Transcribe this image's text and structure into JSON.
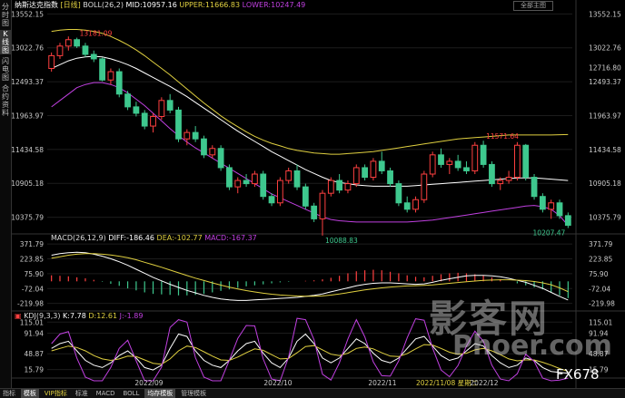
{
  "sidebar": {
    "items": [
      "分时图",
      "K线图",
      "闪电图",
      "合约资料"
    ]
  },
  "header": {
    "name": "纳斯达克指数",
    "period": "[日线]",
    "boll_label": "BOLL(26,2)",
    "mid": "MID:10957.16",
    "upper": "UPPER:11666.83",
    "lower": "LOWER:10247.49",
    "dropdown": "全部主图"
  },
  "macd_header": {
    "name": "MACD(26,12,9)",
    "diff": "DIFF:-186.46",
    "dea": "DEA:-102.77",
    "macd": "MACD:-167.37"
  },
  "kdj_header": {
    "name": "KDJ(9,3,3)",
    "k": "K:7.78",
    "d": "D:12.61",
    "j": "J:-1.89"
  },
  "colors": {
    "up": "#ff4040",
    "down": "#3ec88e",
    "mid": "#ffffff",
    "upper": "#e0d040",
    "lower": "#c040e0"
  },
  "chart_data": [
    {
      "type": "candlestick",
      "name": "纳斯达克指数",
      "x_labels": [
        "2022/09",
        "2022/10",
        "2022/11",
        "2022/11/08 星期二",
        "2022/12"
      ],
      "ylim": [
        10200,
        13600
      ],
      "y_ticks": [
        13552.15,
        13022.76,
        12493.37,
        11963.97,
        11434.58,
        10905.18,
        10375.79
      ],
      "right_extra_tick": 12716.8,
      "annotations": [
        {
          "text": "13181.09",
          "value": 13181.09
        },
        {
          "text": "10088.83",
          "value": 10088.83
        },
        {
          "text": "11571.64",
          "value": 11571.64
        },
        {
          "text": "10207.47",
          "value": 10207.47
        }
      ],
      "ohlc": [
        [
          12700,
          12950,
          12650,
          12900
        ],
        [
          12900,
          13100,
          12850,
          13050
        ],
        [
          13050,
          13200,
          12980,
          13150
        ],
        [
          13150,
          13181,
          13020,
          13050
        ],
        [
          13050,
          13100,
          12880,
          12920
        ],
        [
          12920,
          12980,
          12800,
          12850
        ],
        [
          12850,
          12870,
          12500,
          12520
        ],
        [
          12520,
          12700,
          12450,
          12650
        ],
        [
          12650,
          12700,
          12250,
          12300
        ],
        [
          12300,
          12350,
          12050,
          12100
        ],
        [
          12100,
          12180,
          11950,
          12000
        ],
        [
          12000,
          12050,
          11750,
          11800
        ],
        [
          11800,
          12000,
          11700,
          11950
        ],
        [
          11950,
          12250,
          11900,
          12200
        ],
        [
          12200,
          12300,
          12000,
          12050
        ],
        [
          12050,
          12100,
          11550,
          11600
        ],
        [
          11600,
          11750,
          11500,
          11700
        ],
        [
          11700,
          11800,
          11550,
          11600
        ],
        [
          11600,
          11650,
          11300,
          11350
        ],
        [
          11350,
          11500,
          11300,
          11450
        ],
        [
          11450,
          11500,
          11100,
          11150
        ],
        [
          11150,
          11200,
          10800,
          10850
        ],
        [
          10850,
          11000,
          10750,
          10950
        ],
        [
          10950,
          11050,
          10850,
          10900
        ],
        [
          10900,
          11100,
          10850,
          11050
        ],
        [
          11050,
          11100,
          10650,
          10700
        ],
        [
          10700,
          10750,
          10550,
          10600
        ],
        [
          10600,
          11000,
          10550,
          10950
        ],
        [
          10950,
          11150,
          10900,
          11100
        ],
        [
          11100,
          11200,
          10800,
          10850
        ],
        [
          10850,
          10900,
          10500,
          10550
        ],
        [
          10550,
          10600,
          10300,
          10350
        ],
        [
          10350,
          10800,
          10088,
          10750
        ],
        [
          10750,
          11000,
          10700,
          10950
        ],
        [
          10950,
          11050,
          10750,
          10800
        ],
        [
          10800,
          10950,
          10750,
          10900
        ],
        [
          10900,
          11200,
          10850,
          11150
        ],
        [
          11150,
          11200,
          10950,
          11000
        ],
        [
          11000,
          11300,
          10950,
          11250
        ],
        [
          11250,
          11400,
          11050,
          11100
        ],
        [
          11100,
          11150,
          10850,
          10900
        ],
        [
          10900,
          10950,
          10550,
          10600
        ],
        [
          10600,
          10700,
          10450,
          10500
        ],
        [
          10500,
          10700,
          10450,
          10650
        ],
        [
          10650,
          11100,
          10600,
          11050
        ],
        [
          11050,
          11400,
          11000,
          11350
        ],
        [
          11350,
          11450,
          11150,
          11200
        ],
        [
          11200,
          11300,
          11050,
          11250
        ],
        [
          11250,
          11350,
          11100,
          11150
        ],
        [
          11150,
          11250,
          11050,
          11100
        ],
        [
          11100,
          11550,
          11050,
          11500
        ],
        [
          11500,
          11571,
          11150,
          11200
        ],
        [
          11200,
          11250,
          10850,
          10900
        ],
        [
          10900,
          11000,
          10800,
          10950
        ],
        [
          10950,
          11100,
          10900,
          11000
        ],
        [
          11000,
          11550,
          10950,
          11500
        ],
        [
          11500,
          11520,
          10950,
          11000
        ],
        [
          11000,
          11050,
          10650,
          10700
        ],
        [
          10700,
          10750,
          10450,
          10500
        ],
        [
          10500,
          10650,
          10350,
          10600
        ],
        [
          10600,
          10650,
          10350,
          10400
        ],
        [
          10400,
          10450,
          10207,
          10250
        ]
      ],
      "boll_mid": [
        12700,
        12760,
        12820,
        12860,
        12880,
        12890,
        12880,
        12850,
        12810,
        12760,
        12700,
        12630,
        12560,
        12490,
        12420,
        12340,
        12260,
        12170,
        12080,
        11990,
        11900,
        11810,
        11720,
        11640,
        11560,
        11480,
        11400,
        11330,
        11260,
        11190,
        11120,
        11060,
        11000,
        10950,
        10920,
        10900,
        10880,
        10870,
        10860,
        10860,
        10860,
        10860,
        10860,
        10870,
        10880,
        10890,
        10900,
        10910,
        10920,
        10930,
        10940,
        10950,
        10960,
        10970,
        10980,
        10990,
        10990,
        10990,
        10980,
        10970,
        10960,
        10950
      ],
      "boll_upper": [
        13280,
        13300,
        13310,
        13310,
        13300,
        13280,
        13250,
        13200,
        13140,
        13070,
        12990,
        12900,
        12800,
        12700,
        12600,
        12490,
        12380,
        12270,
        12160,
        12060,
        11960,
        11870,
        11790,
        11710,
        11640,
        11580,
        11530,
        11490,
        11450,
        11420,
        11400,
        11380,
        11370,
        11360,
        11360,
        11370,
        11380,
        11390,
        11400,
        11420,
        11440,
        11460,
        11480,
        11500,
        11520,
        11540,
        11560,
        11580,
        11600,
        11610,
        11620,
        11630,
        11640,
        11650,
        11660,
        11660,
        11660,
        11660,
        11660,
        11660,
        11665,
        11667
      ],
      "boll_lower": [
        12100,
        12200,
        12300,
        12400,
        12450,
        12480,
        12480,
        12450,
        12400,
        12320,
        12220,
        12120,
        12000,
        11880,
        11760,
        11650,
        11550,
        11460,
        11380,
        11300,
        11220,
        11140,
        11060,
        10980,
        10900,
        10820,
        10740,
        10680,
        10620,
        10560,
        10500,
        10440,
        10380,
        10340,
        10320,
        10310,
        10300,
        10300,
        10300,
        10300,
        10300,
        10300,
        10300,
        10310,
        10320,
        10330,
        10350,
        10370,
        10390,
        10410,
        10430,
        10450,
        10470,
        10490,
        10510,
        10530,
        10550,
        10560,
        10540,
        10500,
        10400,
        10247
      ]
    },
    {
      "type": "bar+line",
      "name": "MACD(26,12,9)",
      "ylim": [
        -250,
        400
      ],
      "y_ticks": [
        371.79,
        223.85,
        75.9,
        -72.04,
        -219.98
      ],
      "histogram": [
        60,
        55,
        50,
        40,
        30,
        15,
        -5,
        -25,
        -45,
        -70,
        -90,
        -110,
        -125,
        -130,
        -135,
        -140,
        -140,
        -135,
        -125,
        -110,
        -95,
        -80,
        -65,
        -50,
        -40,
        -30,
        -20,
        -10,
        -5,
        0,
        5,
        10,
        20,
        35,
        55,
        80,
        100,
        110,
        115,
        110,
        95,
        80,
        60,
        45,
        40,
        55,
        70,
        80,
        85,
        80,
        70,
        60,
        40,
        20,
        0,
        -20,
        -40,
        -60,
        -80,
        -110,
        -140,
        -167
      ],
      "diff": [
        260,
        275,
        285,
        290,
        285,
        270,
        250,
        225,
        195,
        160,
        120,
        80,
        40,
        5,
        -30,
        -60,
        -90,
        -115,
        -140,
        -160,
        -175,
        -185,
        -190,
        -190,
        -185,
        -180,
        -175,
        -170,
        -165,
        -160,
        -150,
        -140,
        -125,
        -105,
        -85,
        -65,
        -45,
        -30,
        -20,
        -15,
        -15,
        -20,
        -25,
        -30,
        -25,
        -10,
        10,
        25,
        40,
        55,
        60,
        60,
        55,
        45,
        30,
        10,
        -10,
        -40,
        -70,
        -110,
        -150,
        -186
      ],
      "dea": [
        230,
        245,
        260,
        270,
        275,
        275,
        270,
        262,
        250,
        235,
        215,
        190,
        165,
        140,
        112,
        85,
        58,
        32,
        8,
        -15,
        -38,
        -58,
        -76,
        -92,
        -106,
        -118,
        -128,
        -136,
        -142,
        -146,
        -148,
        -148,
        -145,
        -137,
        -126,
        -113,
        -99,
        -86,
        -75,
        -65,
        -57,
        -51,
        -46,
        -43,
        -40,
        -35,
        -28,
        -20,
        -12,
        -4,
        3,
        9,
        13,
        15,
        15,
        12,
        7,
        -2,
        -15,
        -34,
        -65,
        -103
      ]
    },
    {
      "type": "line",
      "name": "KDJ(9,3,3)",
      "ylim": [
        0,
        125
      ],
      "y_ticks": [
        115.01,
        91.94,
        48.87,
        15.79
      ],
      "k": [
        60,
        70,
        75,
        55,
        35,
        25,
        20,
        30,
        45,
        55,
        40,
        20,
        15,
        25,
        60,
        90,
        85,
        55,
        35,
        25,
        20,
        35,
        55,
        70,
        75,
        50,
        30,
        20,
        40,
        75,
        90,
        70,
        40,
        30,
        40,
        60,
        80,
        70,
        50,
        35,
        30,
        40,
        60,
        80,
        85,
        65,
        45,
        35,
        40,
        55,
        70,
        65,
        45,
        30,
        20,
        25,
        40,
        35,
        20,
        12,
        10,
        8
      ],
      "d": [
        55,
        60,
        65,
        62,
        55,
        45,
        38,
        35,
        38,
        44,
        43,
        36,
        29,
        27,
        38,
        55,
        65,
        62,
        53,
        44,
        36,
        35,
        42,
        51,
        59,
        56,
        47,
        38,
        39,
        51,
        64,
        66,
        57,
        48,
        45,
        50,
        60,
        63,
        59,
        51,
        44,
        43,
        49,
        59,
        68,
        67,
        60,
        52,
        48,
        50,
        57,
        60,
        55,
        47,
        38,
        34,
        36,
        36,
        31,
        25,
        18,
        12
      ],
      "j": [
        70,
        90,
        95,
        40,
        0,
        -15,
        -15,
        20,
        60,
        77,
        34,
        -12,
        -13,
        21,
        104,
        120,
        115,
        41,
        0,
        -13,
        -12,
        35,
        81,
        108,
        107,
        38,
        -4,
        -16,
        42,
        123,
        120,
        78,
        6,
        -6,
        30,
        80,
        120,
        84,
        32,
        3,
        2,
        34,
        82,
        122,
        119,
        61,
        15,
        1,
        24,
        65,
        96,
        75,
        25,
        -4,
        -16,
        7,
        48,
        33,
        -2,
        -14,
        -6,
        -2
      ]
    }
  ],
  "bottom_tabs": [
    "指标",
    "模板",
    "VIP指标",
    "标准",
    "MACD",
    "BOLL",
    "均存模板",
    "管理模板"
  ],
  "watermark": {
    "main": "影客网",
    "sub": "Phoer.com",
    "brand": "FX678"
  }
}
